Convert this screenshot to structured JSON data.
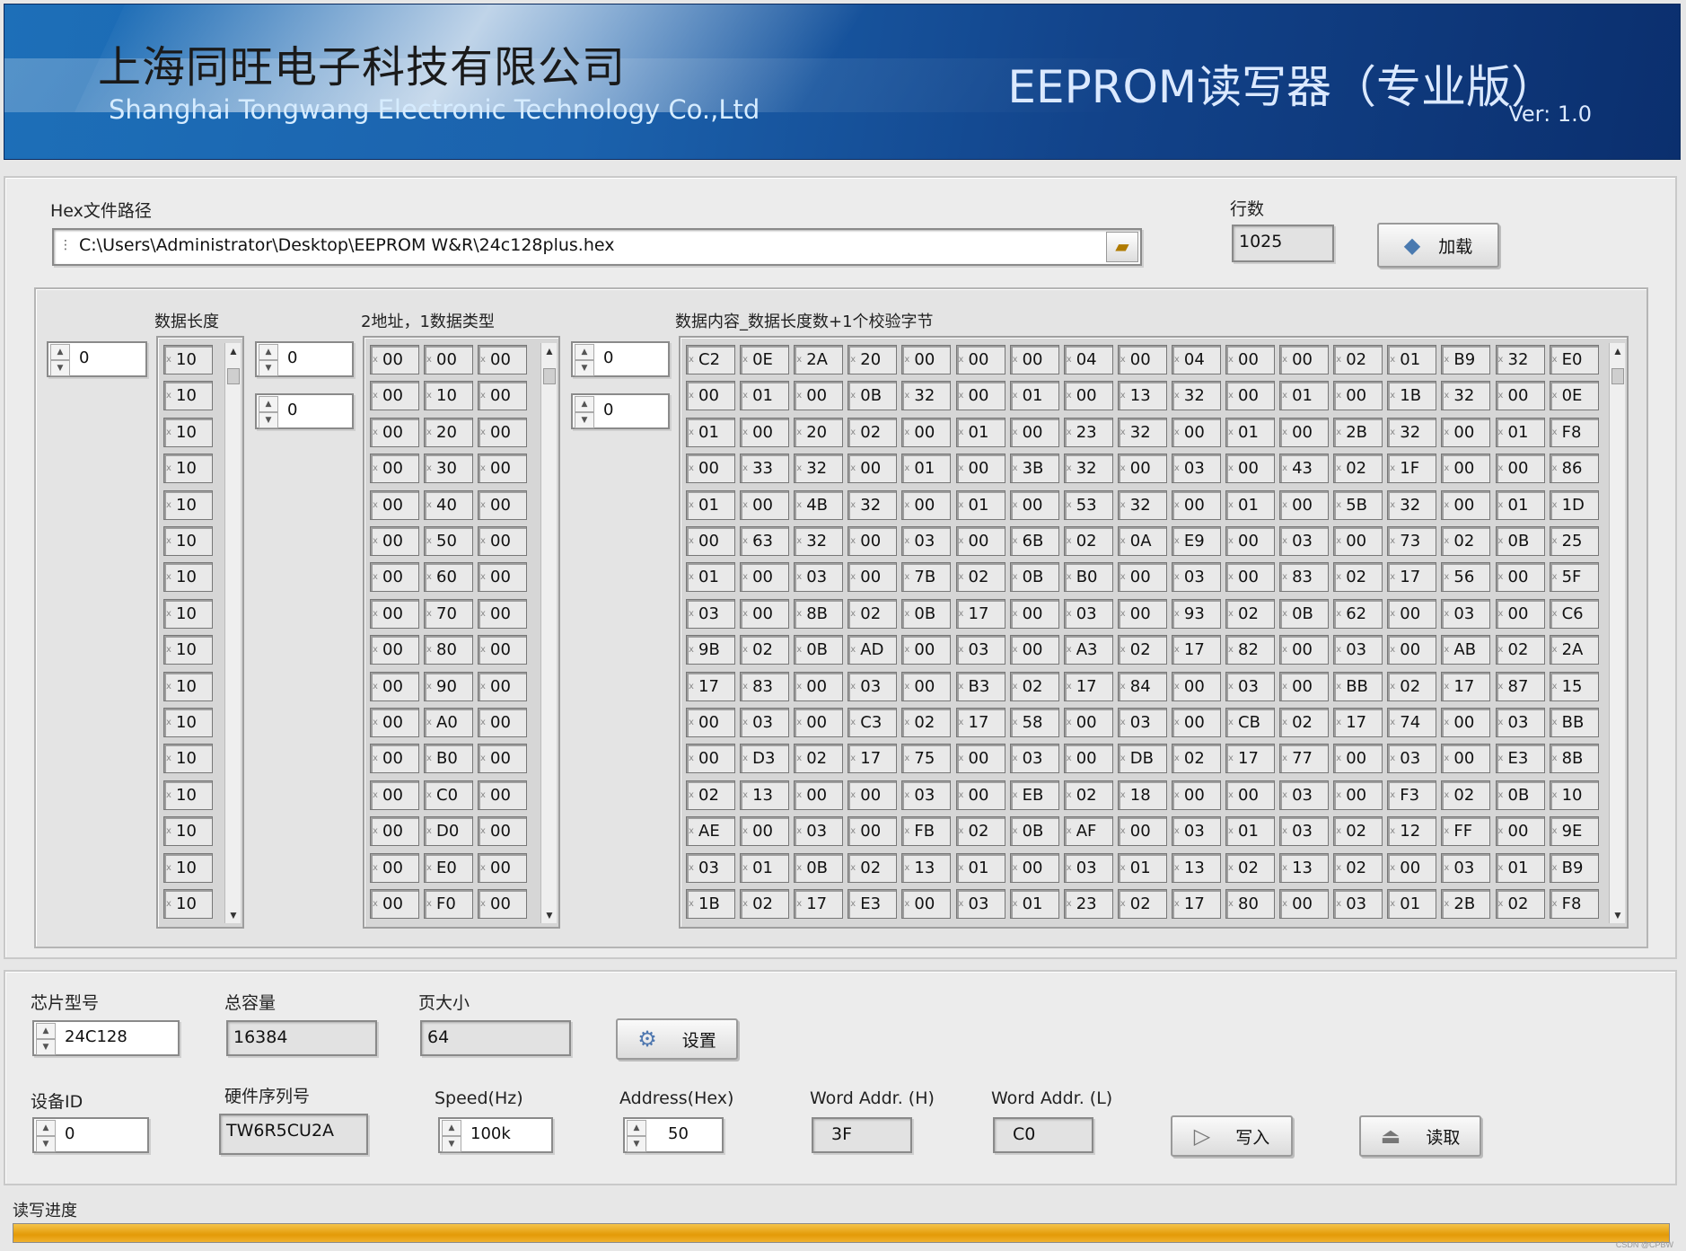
{
  "header": {
    "company_cn": "上海同旺电子科技有限公司",
    "company_en": "Shanghai Tongwang Electronic Technology Co.,Ltd",
    "app_title": "EEPROM读写器（专业版）",
    "version": "Ver:  1.0"
  },
  "file": {
    "label": "Hex文件路径",
    "path": "C:\\Users\\Administrator\\Desktop\\EEPROM W&R\\24c128plus.hex",
    "rows_label": "行数",
    "rows": "1025",
    "load_label": "加载"
  },
  "arrays": {
    "len_label": "数据长度",
    "addr_label": "2地址，1数据类型",
    "content_label": "数据内容_数据长度数+1个校验字节",
    "len_index": "0",
    "addr_index1": "0",
    "addr_index2": "0",
    "content_index1": "0",
    "content_index2": "0",
    "len_values": [
      "10",
      "10",
      "10",
      "10",
      "10",
      "10",
      "10",
      "10",
      "10",
      "10",
      "10",
      "10",
      "10",
      "10",
      "10",
      "10"
    ],
    "addr_rows": [
      [
        "00",
        "00",
        "00"
      ],
      [
        "00",
        "10",
        "00"
      ],
      [
        "00",
        "20",
        "00"
      ],
      [
        "00",
        "30",
        "00"
      ],
      [
        "00",
        "40",
        "00"
      ],
      [
        "00",
        "50",
        "00"
      ],
      [
        "00",
        "60",
        "00"
      ],
      [
        "00",
        "70",
        "00"
      ],
      [
        "00",
        "80",
        "00"
      ],
      [
        "00",
        "90",
        "00"
      ],
      [
        "00",
        "A0",
        "00"
      ],
      [
        "00",
        "B0",
        "00"
      ],
      [
        "00",
        "C0",
        "00"
      ],
      [
        "00",
        "D0",
        "00"
      ],
      [
        "00",
        "E0",
        "00"
      ],
      [
        "00",
        "F0",
        "00"
      ]
    ],
    "content_rows": [
      [
        "C2",
        "0E",
        "2A",
        "20",
        "00",
        "00",
        "00",
        "04",
        "00",
        "04",
        "00",
        "00",
        "02",
        "01",
        "B9",
        "32",
        "E0"
      ],
      [
        "00",
        "01",
        "00",
        "0B",
        "32",
        "00",
        "01",
        "00",
        "13",
        "32",
        "00",
        "01",
        "00",
        "1B",
        "32",
        "00",
        "0E"
      ],
      [
        "01",
        "00",
        "20",
        "02",
        "00",
        "01",
        "00",
        "23",
        "32",
        "00",
        "01",
        "00",
        "2B",
        "32",
        "00",
        "01",
        "F8"
      ],
      [
        "00",
        "33",
        "32",
        "00",
        "01",
        "00",
        "3B",
        "32",
        "00",
        "03",
        "00",
        "43",
        "02",
        "1F",
        "00",
        "00",
        "86"
      ],
      [
        "01",
        "00",
        "4B",
        "32",
        "00",
        "01",
        "00",
        "53",
        "32",
        "00",
        "01",
        "00",
        "5B",
        "32",
        "00",
        "01",
        "1D"
      ],
      [
        "00",
        "63",
        "32",
        "00",
        "03",
        "00",
        "6B",
        "02",
        "0A",
        "E9",
        "00",
        "03",
        "00",
        "73",
        "02",
        "0B",
        "25"
      ],
      [
        "01",
        "00",
        "03",
        "00",
        "7B",
        "02",
        "0B",
        "B0",
        "00",
        "03",
        "00",
        "83",
        "02",
        "17",
        "56",
        "00",
        "5F"
      ],
      [
        "03",
        "00",
        "8B",
        "02",
        "0B",
        "17",
        "00",
        "03",
        "00",
        "93",
        "02",
        "0B",
        "62",
        "00",
        "03",
        "00",
        "C6"
      ],
      [
        "9B",
        "02",
        "0B",
        "AD",
        "00",
        "03",
        "00",
        "A3",
        "02",
        "17",
        "82",
        "00",
        "03",
        "00",
        "AB",
        "02",
        "2A"
      ],
      [
        "17",
        "83",
        "00",
        "03",
        "00",
        "B3",
        "02",
        "17",
        "84",
        "00",
        "03",
        "00",
        "BB",
        "02",
        "17",
        "87",
        "15"
      ],
      [
        "00",
        "03",
        "00",
        "C3",
        "02",
        "17",
        "58",
        "00",
        "03",
        "00",
        "CB",
        "02",
        "17",
        "74",
        "00",
        "03",
        "BB"
      ],
      [
        "00",
        "D3",
        "02",
        "17",
        "75",
        "00",
        "03",
        "00",
        "DB",
        "02",
        "17",
        "77",
        "00",
        "03",
        "00",
        "E3",
        "8B"
      ],
      [
        "02",
        "13",
        "00",
        "00",
        "03",
        "00",
        "EB",
        "02",
        "18",
        "00",
        "00",
        "03",
        "00",
        "F3",
        "02",
        "0B",
        "10"
      ],
      [
        "AE",
        "00",
        "03",
        "00",
        "FB",
        "02",
        "0B",
        "AF",
        "00",
        "03",
        "01",
        "03",
        "02",
        "12",
        "FF",
        "00",
        "9E"
      ],
      [
        "03",
        "01",
        "0B",
        "02",
        "13",
        "01",
        "00",
        "03",
        "01",
        "13",
        "02",
        "13",
        "02",
        "00",
        "03",
        "01",
        "B9"
      ],
      [
        "1B",
        "02",
        "17",
        "E3",
        "00",
        "03",
        "01",
        "23",
        "02",
        "17",
        "80",
        "00",
        "03",
        "01",
        "2B",
        "02",
        "F8"
      ]
    ]
  },
  "device": {
    "chip_label": "芯片型号",
    "chip": "24C128",
    "capacity_label": "总容量",
    "capacity": "16384",
    "page_label": "页大小",
    "page": "64",
    "set_label": "设置",
    "id_label": "设备ID",
    "id": "0",
    "serial_label": "硬件序列号",
    "serial": "TW6R5CU2A",
    "speed_label": "Speed(Hz)",
    "speed": "100k",
    "address_label": "Address(Hex)",
    "address": "50",
    "wah_label": "Word Addr. (H)",
    "wah": "3F",
    "wal_label": "Word Addr. (L)",
    "wal": "C0",
    "write_label": "写入",
    "read_label": "读取"
  },
  "progress": {
    "label": "读写进度",
    "value": 1.0
  },
  "watermark": "CSDN @CPBW"
}
